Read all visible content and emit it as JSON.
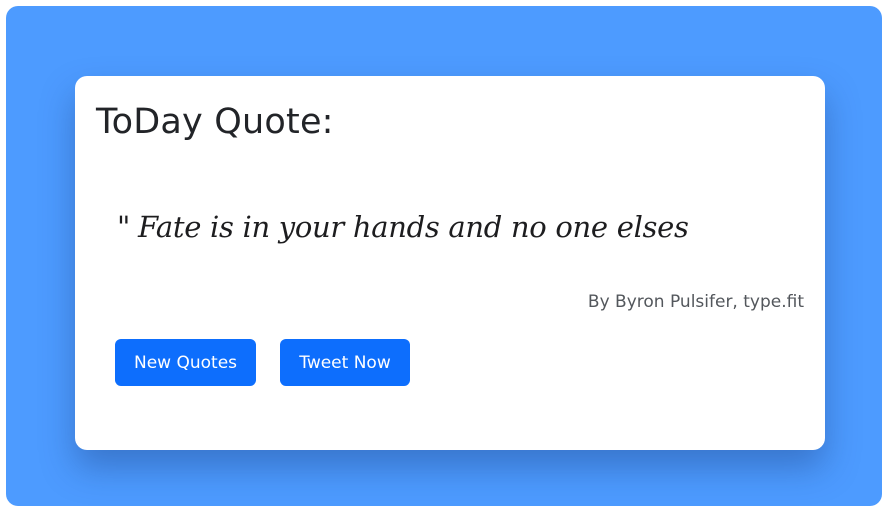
{
  "card": {
    "title": "ToDay Quote:"
  },
  "quote": {
    "mark": "\"",
    "text": "Fate is in your hands and no one elses",
    "author": "By Byron Pulsifer, type.fit"
  },
  "actions": {
    "new_quotes_label": "New Quotes",
    "tweet_now_label": "Tweet Now"
  },
  "colors": {
    "page_background": "#4d9bff",
    "card_background": "#ffffff",
    "button_primary": "#0d6efd",
    "title_text": "#222428",
    "author_text": "#53575c"
  }
}
